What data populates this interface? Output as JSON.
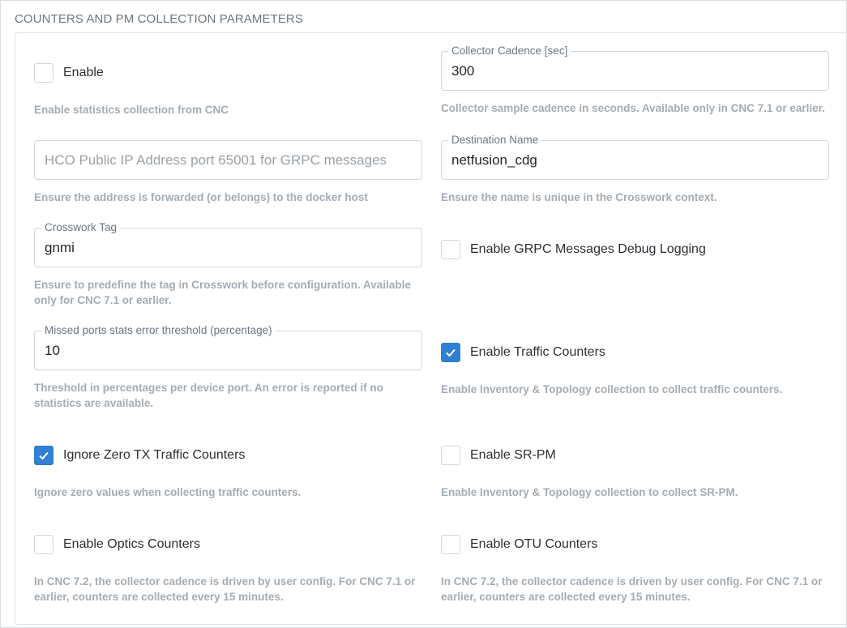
{
  "section_title": "COUNTERS AND PM COLLECTION PARAMETERS",
  "colors": {
    "accent": "#2f7fd2",
    "help_text": "#a5acb4",
    "border": "#d2d6db"
  },
  "left": {
    "enable": {
      "label": "Enable",
      "checked": false,
      "help": "Enable statistics collection from CNC"
    },
    "hco_address": {
      "placeholder": "HCO Public IP Address port 65001 for GRPC messages",
      "value": "",
      "help": "Ensure the address is forwarded (or belongs) to the docker host"
    },
    "crosswork_tag": {
      "legend": "Crosswork Tag",
      "value": "gnmi",
      "help_line1": "Ensure to predefine the tag in Crosswork before configuration. Available",
      "help_line2": "only for CNC 7.1 or earlier."
    },
    "missed_ports": {
      "legend": "Missed ports stats error threshold (percentage)",
      "value": "10",
      "help_line1": "Threshold in percentages per device port. An error is reported if no",
      "help_line2": "statistics are available."
    },
    "ignore_zero_tx": {
      "label": "Ignore Zero TX Traffic Counters",
      "checked": true,
      "help": "Ignore zero values when collecting traffic counters."
    },
    "optics": {
      "label": "Enable Optics Counters",
      "checked": false,
      "help_line1": "In CNC 7.2, the collector cadence is driven by user config. For CNC 7.1 or",
      "help_line2": "earlier, counters are collected every 15 minutes."
    }
  },
  "right": {
    "collector_cadence": {
      "legend": "Collector Cadence [sec]",
      "value": "300",
      "help": "Collector sample cadence in seconds. Available only in CNC 7.1 or earlier."
    },
    "destination_name": {
      "legend": "Destination Name",
      "value": "netfusion_cdg",
      "help": "Ensure the name is unique in the Crosswork context."
    },
    "grpc_debug": {
      "label": "Enable GRPC Messages Debug Logging",
      "checked": false
    },
    "traffic_counters": {
      "label": "Enable Traffic Counters",
      "checked": true,
      "help": "Enable Inventory & Topology collection to collect traffic counters."
    },
    "sr_pm": {
      "label": "Enable SR-PM",
      "checked": false,
      "help": "Enable Inventory & Topology collection to collect SR-PM."
    },
    "otu": {
      "label": "Enable OTU Counters",
      "checked": false,
      "help_line1": "In CNC 7.2, the collector cadence is driven by user config. For CNC 7.1 or",
      "help_line2": "earlier, counters are collected every 15 minutes."
    }
  }
}
